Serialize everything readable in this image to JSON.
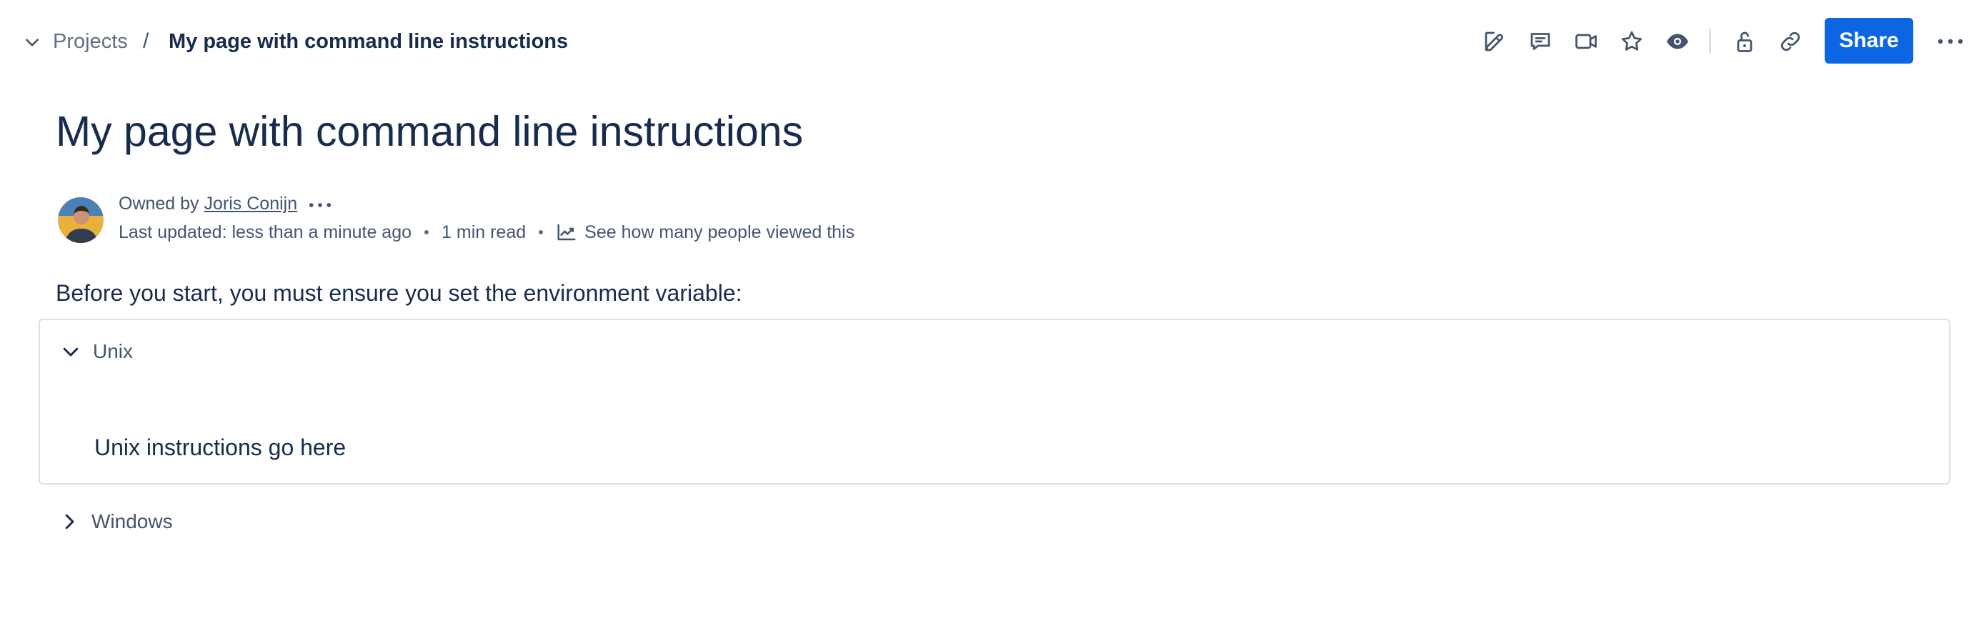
{
  "breadcrumb": {
    "toggle_icon": "chevron-down-icon",
    "parent": "Projects",
    "separator": "/",
    "current": "My page with command line instructions"
  },
  "toolbar": {
    "icons": [
      "edit-icon",
      "comment-icon",
      "video-icon",
      "star-icon",
      "watch-eye-icon",
      "unlock-icon",
      "link-icon",
      "more-icon"
    ],
    "share_label": "Share",
    "accent_color": "#0c66e4"
  },
  "page": {
    "title": "My page with command line instructions"
  },
  "byline": {
    "owned_by": "Owned by",
    "owner": "Joris Conijn",
    "last_updated": "Last updated: less than a minute ago",
    "read_time": "1 min read",
    "views_link": "See how many people viewed this"
  },
  "content": {
    "intro": "Before you start, you must ensure you set the environment variable:",
    "expands": [
      {
        "title": "Unix",
        "expanded": true,
        "body": "Unix instructions go here"
      },
      {
        "title": "Windows",
        "expanded": false
      }
    ]
  }
}
